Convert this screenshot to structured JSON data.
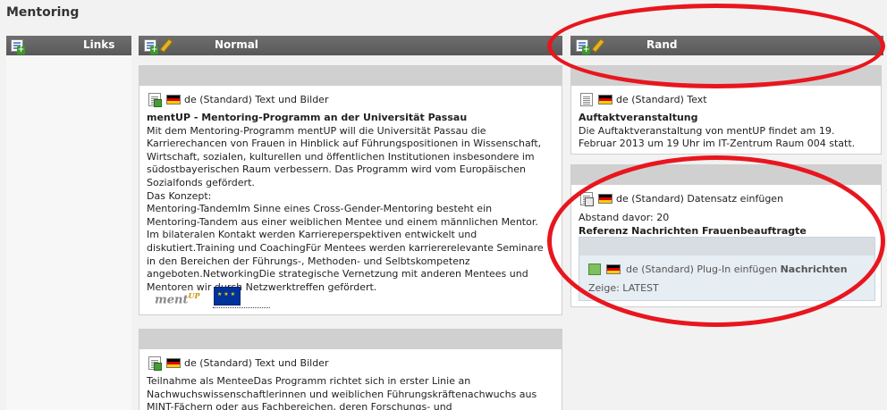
{
  "page": {
    "title": "Mentoring"
  },
  "columns": {
    "links": {
      "label": "Links"
    },
    "normal": {
      "label": "Normal"
    },
    "rand": {
      "label": "Rand"
    }
  },
  "normal_items": [
    {
      "type_label": "de (Standard) Text und Bilder",
      "heading": "mentUP - Mentoring-Programm an der Universität Passau",
      "lines": [
        "Mit dem Mentoring-Programm mentUP will die Universität Passau die",
        "Karrierechancen von Frauen in Hinblick auf Führungspositionen in Wissenschaft,",
        "Wirtschaft, sozialen, kulturellen und öffentlichen Institutionen insbesondere im",
        "südostbayerischen Raum verbessern. Das Programm wird vom Europäischen",
        "Sozialfonds gefördert.",
        "Das Konzept:",
        "Mentoring-TandemIm Sinne eines Cross-Gender-Mentoring besteht ein",
        "Mentoring-Tandem aus einer weiblichen Mentee und einem männlichen Mentor.",
        "Im bilateralen Kontakt werden Karriereperspektiven entwickelt und",
        "diskutiert.Training und CoachingFür Mentees werden karriererelevante Seminare",
        "in den Bereichen der Führungs-, Methoden- und Selbtskompetenz",
        "angeboten.NetworkingDie strategische Vernetzung mit anderen Mentees und",
        "Mentoren wir durch Netzwerktreffen gefördert."
      ],
      "logo_text": "ment",
      "logo_sup": "UP"
    },
    {
      "type_label": "de (Standard) Text und Bilder",
      "lines": [
        "Teilnahme als MenteeDas Programm richtet sich in erster Linie an",
        "Nachwuchswissenschaftlerinnen und weiblichen Führungskräftenachwuchs aus",
        "MINT-Fächern oder aus Fachbereichen, deren Forschungs- und"
      ]
    }
  ],
  "rand_items": [
    {
      "type_label": "de (Standard) Text",
      "heading": "Auftaktveranstaltung",
      "lines": [
        "Die Auftaktveranstaltung von mentUP findet am 19.",
        "Februar 2013 um 19 Uhr im IT-Zentrum Raum 004 statt."
      ]
    },
    {
      "type_label": "de (Standard) Datensatz einfügen",
      "abstand": "Abstand davor: 20",
      "referenz": "Referenz Nachrichten Frauenbeauftragte",
      "plugin": {
        "type_label": "de (Standard) Plug-In einfügen",
        "name": "Nachrichten",
        "zeige": "Zeige: LATEST"
      }
    }
  ],
  "colors": {
    "annotation": "#e8161e",
    "header": "#5e5e5e"
  }
}
